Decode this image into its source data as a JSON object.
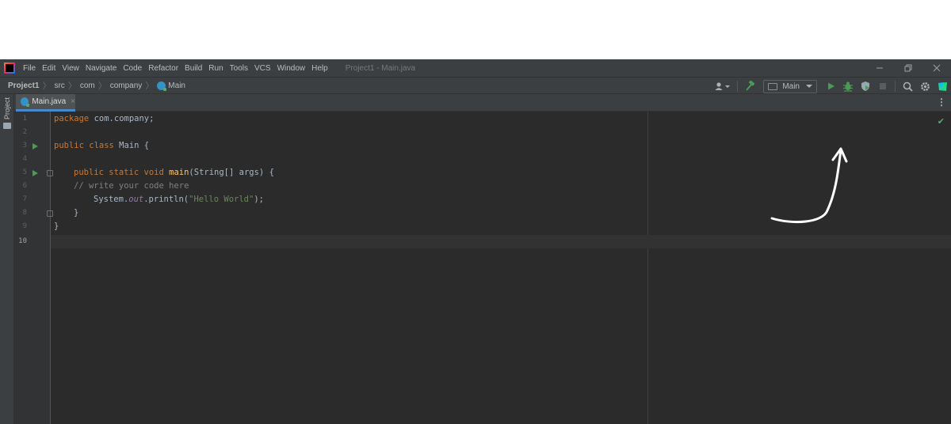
{
  "menu": {
    "items": [
      "File",
      "Edit",
      "View",
      "Navigate",
      "Code",
      "Refactor",
      "Build",
      "Run",
      "Tools",
      "VCS",
      "Window",
      "Help"
    ],
    "window_title": "Project1 - Main.java"
  },
  "breadcrumb": {
    "project": "Project1",
    "src": "src",
    "com": "com",
    "company": "company",
    "main": "Main"
  },
  "toolbar": {
    "run_config": "Main"
  },
  "left_strip": {
    "project_label": "Project"
  },
  "tabs": [
    {
      "label": "Main.java",
      "close": "×"
    }
  ],
  "editor": {
    "line_numbers": [
      "1",
      "2",
      "3",
      "4",
      "5",
      "6",
      "7",
      "8",
      "9",
      "10"
    ],
    "active_line": "10",
    "code": {
      "l1_kw": "package",
      "l1_rest": " com.company;",
      "l3_kw": "public class",
      "l3_rest": " Main {",
      "l5_kw": "public static void",
      "l5_fn": "main",
      "l5_rest": "(String[] args) {",
      "l6_comment": "// write your code here",
      "l7_a": "System.",
      "l7_field": "out",
      "l7_b": ".println(",
      "l7_str": "\"Hello World\"",
      "l7_c": ");",
      "l8": "}",
      "l9": "}"
    }
  },
  "colors": {
    "keyword": "#cc7832",
    "function": "#ffc66d",
    "string": "#6a8759",
    "comment": "#808080",
    "run_green": "#499c54",
    "background": "#2b2b2b"
  },
  "icons": [
    "app-logo",
    "minimize-icon",
    "restore-icon",
    "close-icon",
    "class-icon",
    "user-icon",
    "build-hammer-icon",
    "run-icon",
    "debug-icon",
    "coverage-icon",
    "stop-icon",
    "search-icon",
    "settings-icon",
    "toolbox-icon",
    "folder-icon",
    "more-icon",
    "check-icon"
  ]
}
